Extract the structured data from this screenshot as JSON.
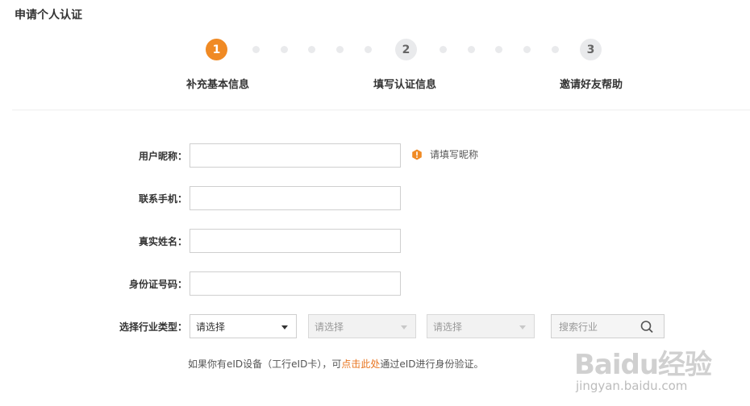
{
  "page": {
    "title": "申请个人认证"
  },
  "steps": [
    {
      "number": "1",
      "label": "补充基本信息",
      "state": "active"
    },
    {
      "number": "2",
      "label": "填写认证信息",
      "state": "inactive"
    },
    {
      "number": "3",
      "label": "邀请好友帮助",
      "state": "inactive"
    }
  ],
  "colors": {
    "accent": "#f08a24",
    "link": "#e8741f",
    "border": "#cfcfcf"
  },
  "form": {
    "nickname": {
      "label": "用户昵称：",
      "value": "",
      "hint": "请填写昵称"
    },
    "phone": {
      "label": "联系手机：",
      "value": ""
    },
    "real_name": {
      "label": "真实姓名：",
      "value": ""
    },
    "id_number": {
      "label": "身份证号码：",
      "value": ""
    },
    "industry": {
      "label": "选择行业类型：",
      "select1": "请选择",
      "select2": "请选择",
      "select3": "请选择",
      "search_placeholder": "搜索行业"
    }
  },
  "eid": {
    "prefix": "如果你有eID设备（工行eID卡），可",
    "link": "点击此处",
    "suffix": "通过eID进行身份验证。"
  },
  "watermark": {
    "main": "Baidu经验",
    "sub": "jingyan.baidu.com"
  }
}
